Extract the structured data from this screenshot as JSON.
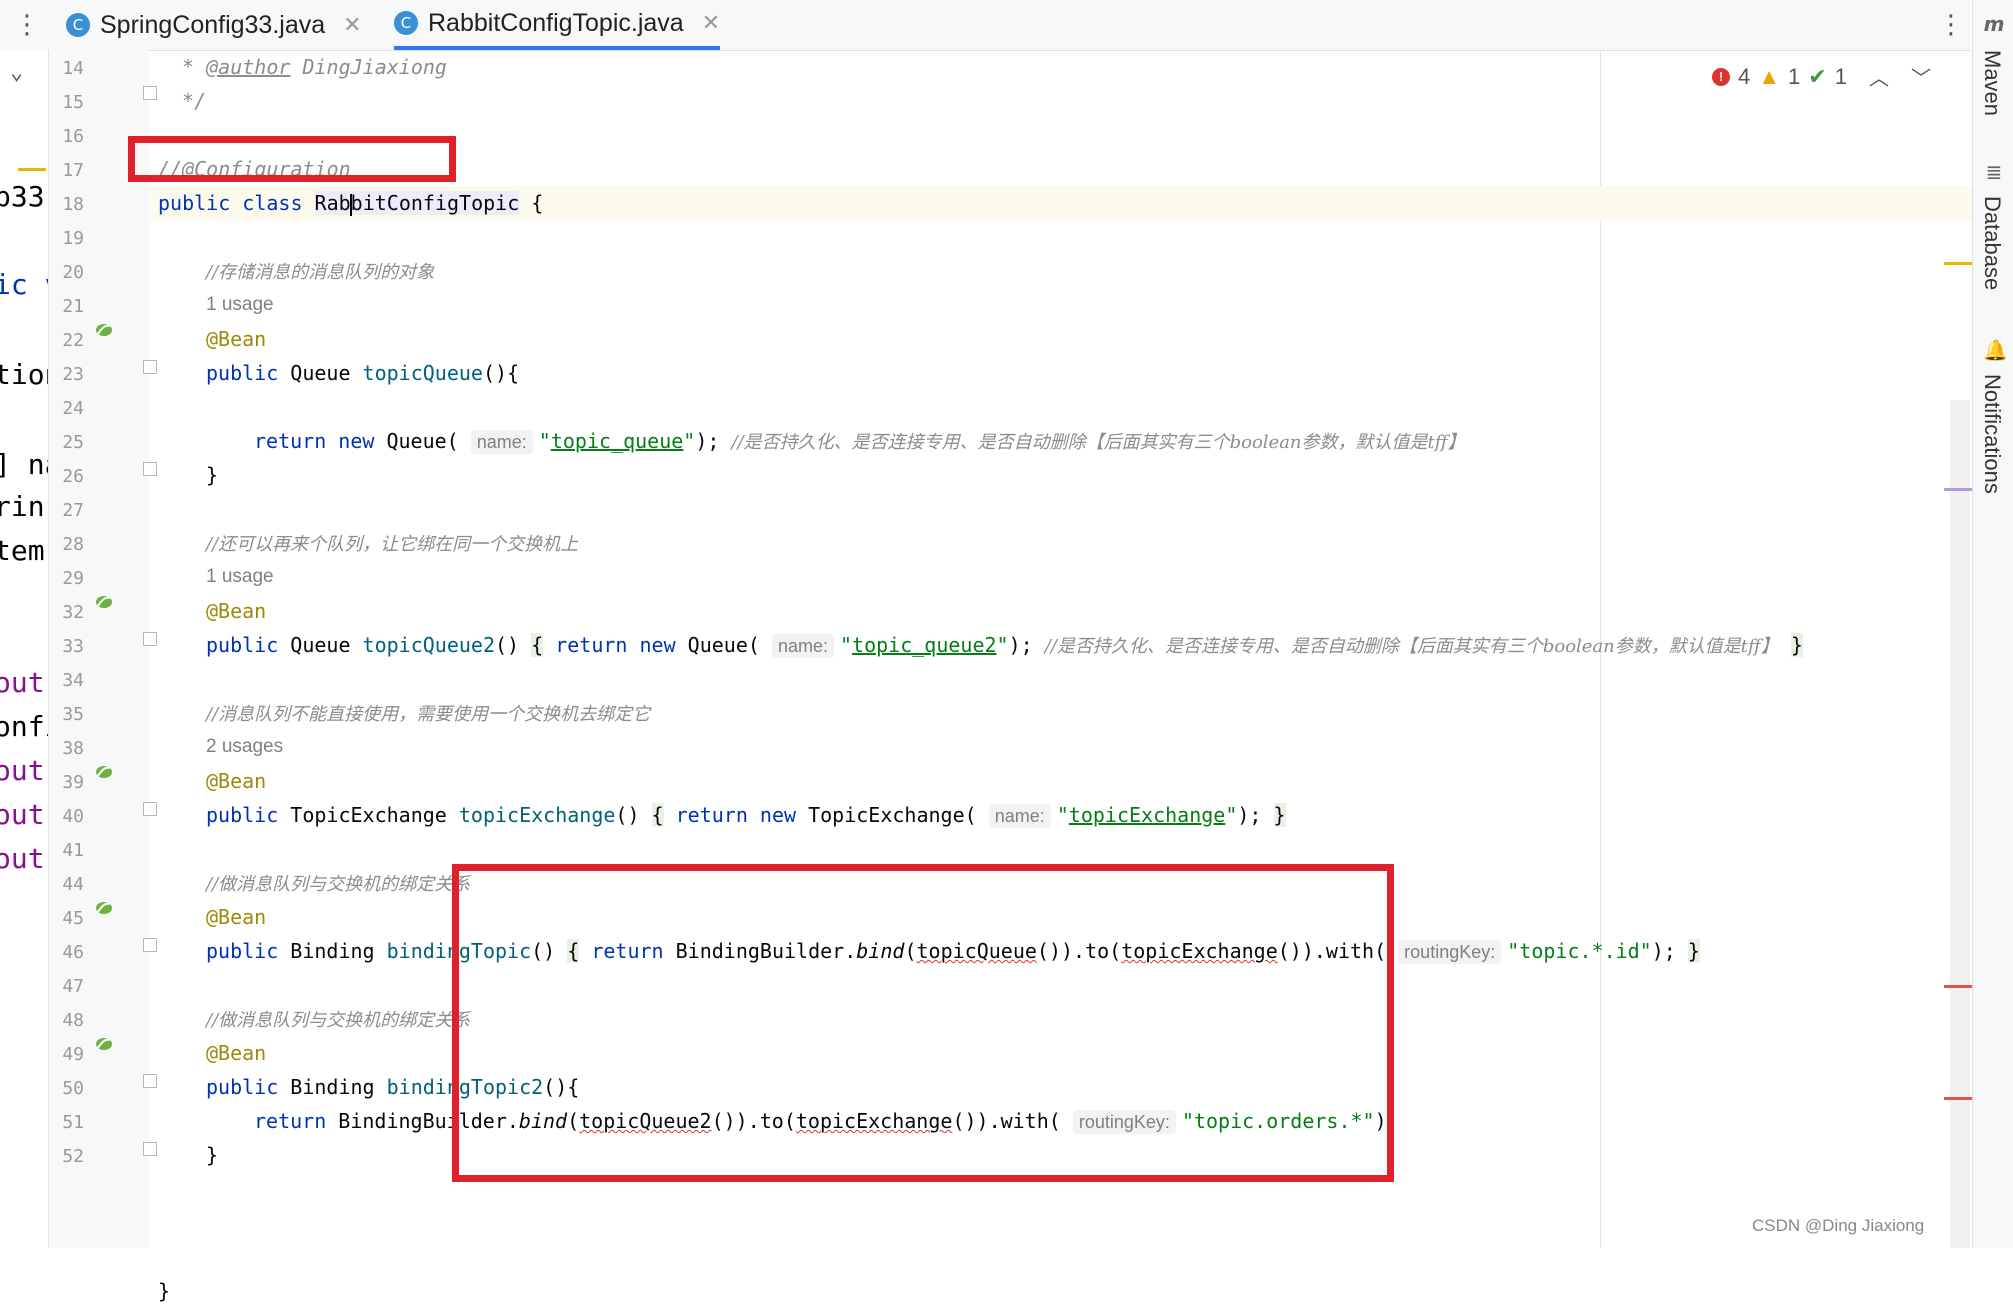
{
  "tabs": [
    {
      "label": "SpringConfig33.java",
      "icon": "C",
      "active": false
    },
    {
      "label": "RabbitConfigTopic.java",
      "icon": "C",
      "active": true
    }
  ],
  "left_fragments": [
    "p33",
    "ic v",
    "tion",
    "] na",
    "rin(",
    "tem",
    "out",
    "onfi",
    "out",
    "out",
    "out"
  ],
  "line_numbers": [
    "14",
    "15",
    "16",
    "17",
    "18",
    "19",
    "20",
    "21",
    "22",
    "23",
    "24",
    "25",
    "26",
    "27",
    "28",
    "29",
    "32",
    "33",
    "34",
    "35",
    "38",
    "39",
    "40",
    "41",
    "44",
    "45",
    "46",
    "47",
    "48",
    "49",
    "50",
    "51",
    "52"
  ],
  "inspections": {
    "errors": "4",
    "warnings": "1",
    "ok": "1"
  },
  "right_panels": [
    "Maven",
    "Database",
    "Notifications"
  ],
  "code": {
    "l14_tag": "@author",
    "l14_rest": " DingJiaxiong",
    "l14_prefix": " * ",
    "l15": " */",
    "l17": "//@Configuration",
    "l18_kw": "public class ",
    "l18_name_a": "Rab",
    "l18_name_b": "bitConfigTopic",
    "l18_brace": " {",
    "c20": "//存储消息的消息队列的对象",
    "usage1": "1 usage",
    "bean": "@Bean",
    "l22_kw": "public ",
    "l22_type": "Queue ",
    "l22_fn": "topicQueue",
    "l22_end": "(){",
    "l24_kw": "return new ",
    "l24_type": "Queue(",
    "hint_name": "name:",
    "l24_str_q1": "\"",
    "l24_str": "topic_queue",
    "l24_str_q2": "\"",
    "l24_end": ");",
    "l24_cmt": "//是否持久化、是否连接专用、是否自动删除【后面其实有三个boolean参数，默认值是tff】",
    "close": "}",
    "c27": "//还可以再来个队列，让它绑在同一个交换机上",
    "usage2": "1 usage",
    "l29_fn": "topicQueue2",
    "l29_paren": "() ",
    "l29_ret": "return new ",
    "l29_type": "Queue(",
    "l29_str": "topic_queue2",
    "l29_cmt": "//是否持久化、是否连接专用、是否自动删除【后面其实有三个boolean参数，默认值是tff】",
    "c33": "//消息队列不能直接使用，需要使用一个交换机去绑定它",
    "usage3": "2 usages",
    "l35_type": "TopicExchange ",
    "l35_fn": "topicExchange",
    "l35_new": "TopicExchange(",
    "l35_str": "topicExchange",
    "c39": "//做消息队列与交换机的绑定关系",
    "l41_type": "Binding ",
    "l41_fn": "bindingTopic",
    "l41_ret": "return ",
    "l41_builder": "BindingBuilder.",
    "l41_bind": "bind",
    "l41_q": "topicQueue",
    "l41_to": ".to(",
    "l41_ex": "topicExchange",
    "l41_with": ".with(",
    "hint_rk": "routingKey:",
    "l41_str": "\"topic.*.id\"",
    "c45": "//做消息队列与交换机的绑定关系",
    "l47_fn": "bindingTopic2",
    "l47_end": "(){",
    "l48_q": "topicQueue2",
    "l48_str": "\"topic.orders.*\"",
    "l52": "}"
  },
  "watermark": "CSDN @Ding Jiaxiong"
}
